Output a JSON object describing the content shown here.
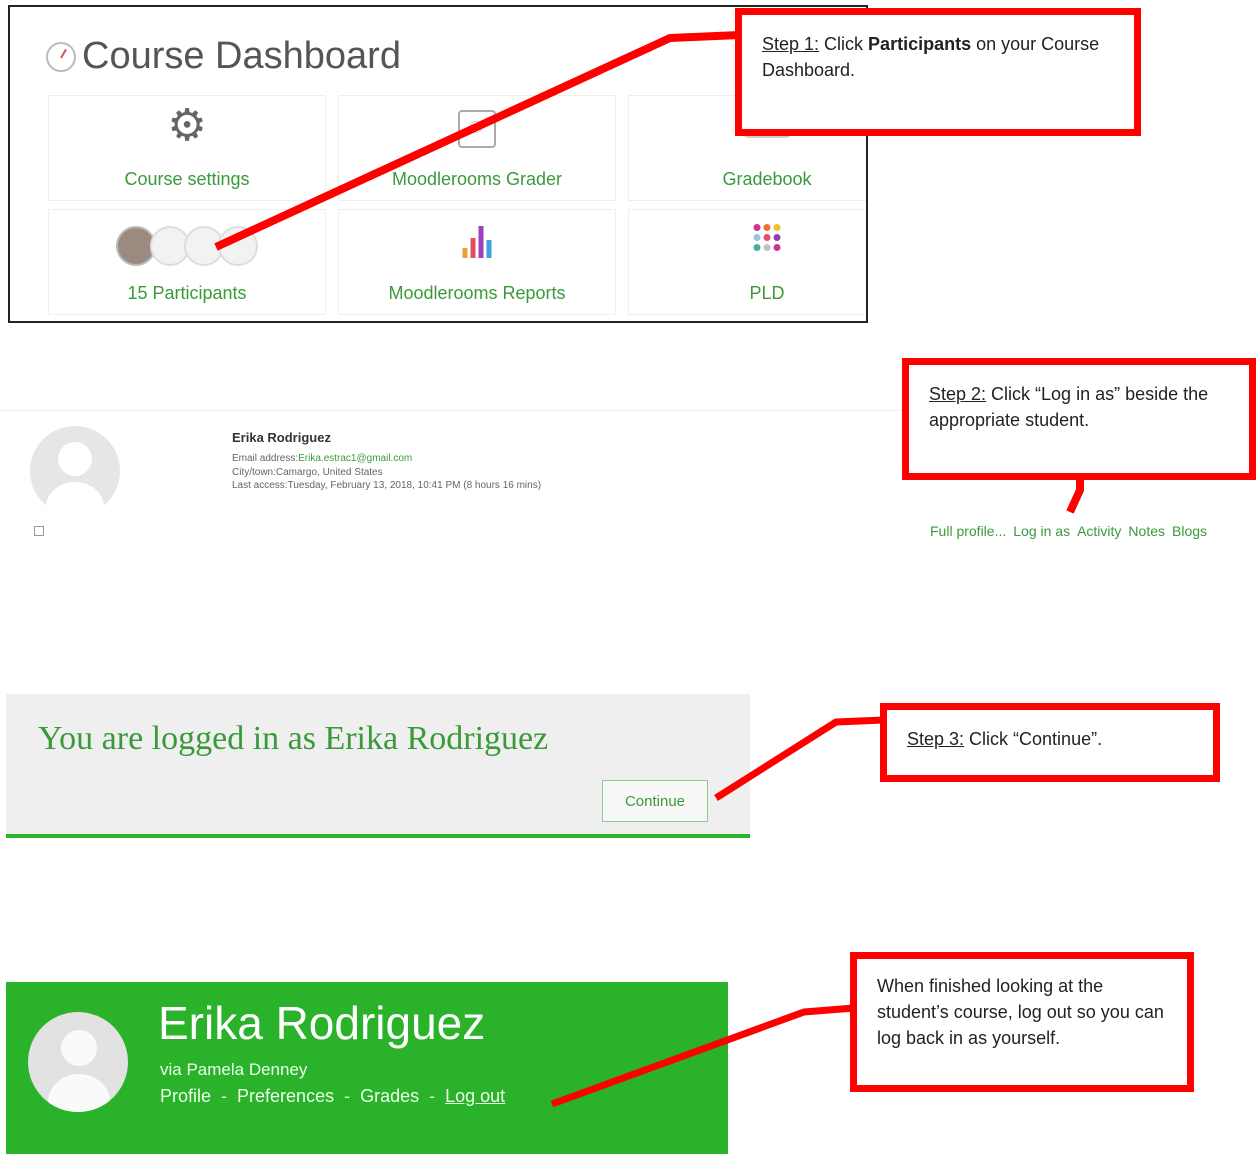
{
  "dashboard": {
    "title": "Course Dashboard",
    "tiles": {
      "course_settings": "Course settings",
      "grader": "Moodlerooms Grader",
      "gradebook": "Gradebook",
      "participants": "15 Participants",
      "reports": "Moodlerooms Reports",
      "pld": "PLD"
    }
  },
  "callouts": {
    "step1": {
      "tag": "Step 1:",
      "pre": " Click ",
      "bold": "Participants",
      "post": " on your Course Dashboard."
    },
    "step2": {
      "tag": "Step 2:",
      "text": " Click “Log in as” beside the appropriate student."
    },
    "step3": {
      "tag": "Step 3:",
      "text": " Click “Continue”."
    },
    "step4": {
      "text": "When finished looking at the student’s course, log out so you can log back in as yourself."
    }
  },
  "participant": {
    "name": "Erika Rodriguez",
    "email_label": "Email address:",
    "email": "Erika.estrac1@gmail.com",
    "city": "City/town:Camargo, United States",
    "last_access": "Last access:Tuesday, February 13, 2018, 10:41 PM  (8 hours 16 mins)",
    "links": [
      "Full profile...",
      "Log in as",
      "Activity",
      "Notes",
      "Blogs"
    ]
  },
  "login_panel": {
    "message": "You are logged in as Erika Rodriguez",
    "continue_label": "Continue"
  },
  "banner": {
    "name": "Erika Rodriguez",
    "via": "via Pamela Denney",
    "links": [
      "Profile",
      "Preferences",
      "Grades",
      "Log out"
    ],
    "separator": "-"
  },
  "colors": {
    "accent_green": "#3a9a3a",
    "banner_green": "#2ab22a",
    "callout_red": "#ff0000"
  }
}
